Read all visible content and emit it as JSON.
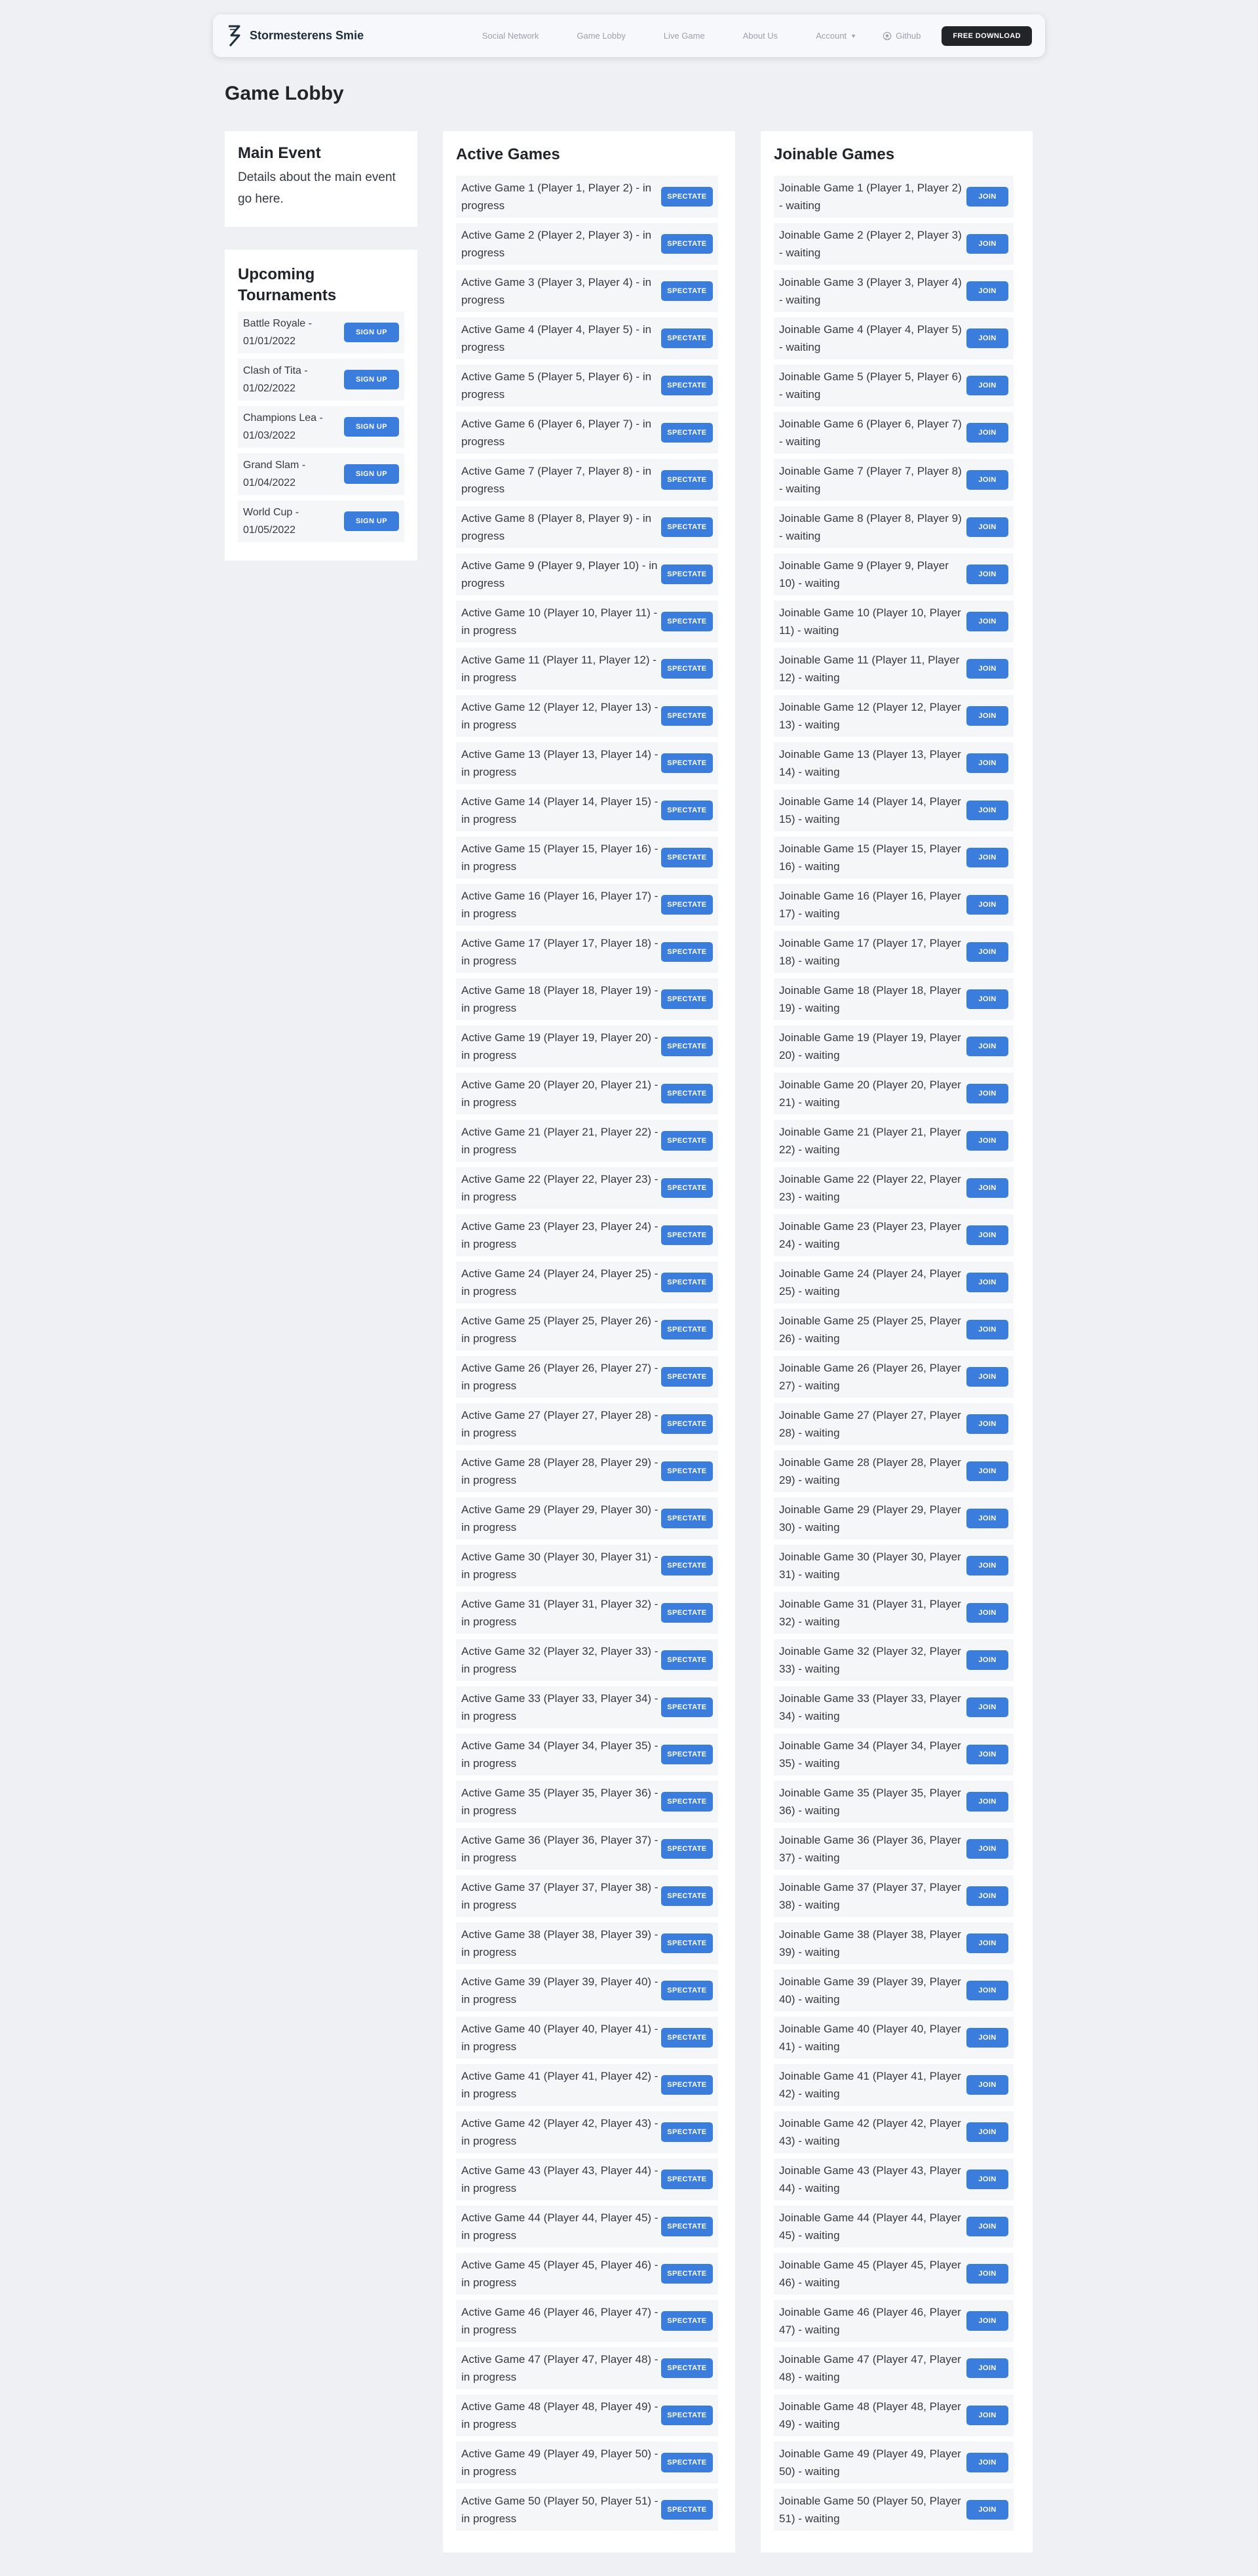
{
  "nav": {
    "brand": "Stormesterens Smie",
    "links": [
      "Social Network",
      "Game Lobby",
      "Live Game",
      "About Us"
    ],
    "account": "Account",
    "github": "Github",
    "download": "Free Download"
  },
  "page_title": "Game Lobby",
  "main_event": {
    "title": "Main Event",
    "details": "Details about the main event go here."
  },
  "tournaments": {
    "title": "Upcoming Tournaments",
    "button_label": "Sign Up",
    "items": [
      "Battle Royale - 01/01/2022",
      "Clash of Tita - 01/02/2022",
      "Champions Lea - 01/03/2022",
      "Grand Slam - 01/04/2022",
      "World Cup - 01/05/2022"
    ]
  },
  "active_games": {
    "title": "Active Games",
    "button_label": "Spectate",
    "items": [
      "Active Game 1 (Player 1, Player 2) - in progress",
      "Active Game 2 (Player 2, Player 3) - in progress",
      "Active Game 3 (Player 3, Player 4) - in progress",
      "Active Game 4 (Player 4, Player 5) - in progress",
      "Active Game 5 (Player 5, Player 6) - in progress",
      "Active Game 6 (Player 6, Player 7) - in progress",
      "Active Game 7 (Player 7, Player 8) - in progress",
      "Active Game 8 (Player 8, Player 9) - in progress",
      "Active Game 9 (Player 9, Player 10) - in progress",
      "Active Game 10 (Player 10, Player 11) - in progress",
      "Active Game 11 (Player 11, Player 12) - in progress",
      "Active Game 12 (Player 12, Player 13) - in progress",
      "Active Game 13 (Player 13, Player 14) - in progress",
      "Active Game 14 (Player 14, Player 15) - in progress",
      "Active Game 15 (Player 15, Player 16) - in progress",
      "Active Game 16 (Player 16, Player 17) - in progress",
      "Active Game 17 (Player 17, Player 18) - in progress",
      "Active Game 18 (Player 18, Player 19) - in progress",
      "Active Game 19 (Player 19, Player 20) - in progress",
      "Active Game 20 (Player 20, Player 21) - in progress",
      "Active Game 21 (Player 21, Player 22) - in progress",
      "Active Game 22 (Player 22, Player 23) - in progress",
      "Active Game 23 (Player 23, Player 24) - in progress",
      "Active Game 24 (Player 24, Player 25) - in progress",
      "Active Game 25 (Player 25, Player 26) - in progress",
      "Active Game 26 (Player 26, Player 27) - in progress",
      "Active Game 27 (Player 27, Player 28) - in progress",
      "Active Game 28 (Player 28, Player 29) - in progress",
      "Active Game 29 (Player 29, Player 30) - in progress",
      "Active Game 30 (Player 30, Player 31) - in progress",
      "Active Game 31 (Player 31, Player 32) - in progress",
      "Active Game 32 (Player 32, Player 33) - in progress",
      "Active Game 33 (Player 33, Player 34) - in progress",
      "Active Game 34 (Player 34, Player 35) - in progress",
      "Active Game 35 (Player 35, Player 36) - in progress",
      "Active Game 36 (Player 36, Player 37) - in progress",
      "Active Game 37 (Player 37, Player 38) - in progress",
      "Active Game 38 (Player 38, Player 39) - in progress",
      "Active Game 39 (Player 39, Player 40) - in progress",
      "Active Game 40 (Player 40, Player 41) - in progress",
      "Active Game 41 (Player 41, Player 42) - in progress",
      "Active Game 42 (Player 42, Player 43) - in progress",
      "Active Game 43 (Player 43, Player 44) - in progress",
      "Active Game 44 (Player 44, Player 45) - in progress",
      "Active Game 45 (Player 45, Player 46) - in progress",
      "Active Game 46 (Player 46, Player 47) - in progress",
      "Active Game 47 (Player 47, Player 48) - in progress",
      "Active Game 48 (Player 48, Player 49) - in progress",
      "Active Game 49 (Player 49, Player 50) - in progress",
      "Active Game 50 (Player 50, Player 51) - in progress"
    ]
  },
  "joinable_games": {
    "title": "Joinable Games",
    "button_label": "Join",
    "items": [
      "Joinable Game 1 (Player 1, Player 2) - waiting",
      "Joinable Game 2 (Player 2, Player 3) - waiting",
      "Joinable Game 3 (Player 3, Player 4) - waiting",
      "Joinable Game 4 (Player 4, Player 5) - waiting",
      "Joinable Game 5 (Player 5, Player 6) - waiting",
      "Joinable Game 6 (Player 6, Player 7) - waiting",
      "Joinable Game 7 (Player 7, Player 8) - waiting",
      "Joinable Game 8 (Player 8, Player 9) - waiting",
      "Joinable Game 9 (Player 9, Player 10) - waiting",
      "Joinable Game 10 (Player 10, Player 11) - waiting",
      "Joinable Game 11 (Player 11, Player 12) - waiting",
      "Joinable Game 12 (Player 12, Player 13) - waiting",
      "Joinable Game 13 (Player 13, Player 14) - waiting",
      "Joinable Game 14 (Player 14, Player 15) - waiting",
      "Joinable Game 15 (Player 15, Player 16) - waiting",
      "Joinable Game 16 (Player 16, Player 17) - waiting",
      "Joinable Game 17 (Player 17, Player 18) - waiting",
      "Joinable Game 18 (Player 18, Player 19) - waiting",
      "Joinable Game 19 (Player 19, Player 20) - waiting",
      "Joinable Game 20 (Player 20, Player 21) - waiting",
      "Joinable Game 21 (Player 21, Player 22) - waiting",
      "Joinable Game 22 (Player 22, Player 23) - waiting",
      "Joinable Game 23 (Player 23, Player 24) - waiting",
      "Joinable Game 24 (Player 24, Player 25) - waiting",
      "Joinable Game 25 (Player 25, Player 26) - waiting",
      "Joinable Game 26 (Player 26, Player 27) - waiting",
      "Joinable Game 27 (Player 27, Player 28) - waiting",
      "Joinable Game 28 (Player 28, Player 29) - waiting",
      "Joinable Game 29 (Player 29, Player 30) - waiting",
      "Joinable Game 30 (Player 30, Player 31) - waiting",
      "Joinable Game 31 (Player 31, Player 32) - waiting",
      "Joinable Game 32 (Player 32, Player 33) - waiting",
      "Joinable Game 33 (Player 33, Player 34) - waiting",
      "Joinable Game 34 (Player 34, Player 35) - waiting",
      "Joinable Game 35 (Player 35, Player 36) - waiting",
      "Joinable Game 36 (Player 36, Player 37) - waiting",
      "Joinable Game 37 (Player 37, Player 38) - waiting",
      "Joinable Game 38 (Player 38, Player 39) - waiting",
      "Joinable Game 39 (Player 39, Player 40) - waiting",
      "Joinable Game 40 (Player 40, Player 41) - waiting",
      "Joinable Game 41 (Player 41, Player 42) - waiting",
      "Joinable Game 42 (Player 42, Player 43) - waiting",
      "Joinable Game 43 (Player 43, Player 44) - waiting",
      "Joinable Game 44 (Player 44, Player 45) - waiting",
      "Joinable Game 45 (Player 45, Player 46) - waiting",
      "Joinable Game 46 (Player 46, Player 47) - waiting",
      "Joinable Game 47 (Player 47, Player 48) - waiting",
      "Joinable Game 48 (Player 48, Player 49) - waiting",
      "Joinable Game 49 (Player 49, Player 50) - waiting",
      "Joinable Game 50 (Player 50, Player 51) - waiting"
    ]
  },
  "colors": {
    "background": "#eef0f4",
    "accent_button": "#3b7ddd",
    "download_button": "#212529",
    "row_background": "#f5f6f8"
  }
}
